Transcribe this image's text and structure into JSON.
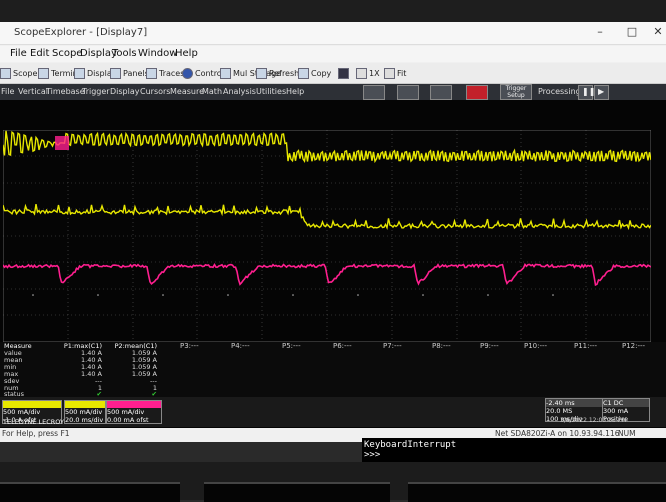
{
  "window": {
    "title": "ScopeExplorer - [Display7]"
  },
  "menu": [
    "File",
    "Edit",
    "Scope",
    "Display",
    "Tools",
    "Window",
    "Help"
  ],
  "toolbar": [
    "Scope",
    "Terminal",
    "Display",
    "Panels",
    "Traces",
    "Control",
    "Mul Storage",
    "Refresh",
    "Copy",
    "1X",
    "Fit"
  ],
  "scope_menu": [
    "File",
    "Vertical",
    "Timebase",
    "Trigger",
    "Display",
    "Cursors",
    "Measure",
    "Math",
    "Analysis",
    "Utilities",
    "Help"
  ],
  "trigger_label": "Trigger Setup",
  "processing_label": "Processing:",
  "measure": {
    "header": [
      "Measure",
      "P1:max(C1)",
      "P2:mean(C1)"
    ],
    "rows": [
      [
        "value",
        "1.40 A",
        "1.059 A"
      ],
      [
        "mean",
        "1.40 A",
        "1.059 A"
      ],
      [
        "min",
        "1.40 A",
        "1.059 A"
      ],
      [
        "max",
        "1.40 A",
        "1.059 A"
      ],
      [
        "sdev",
        "---",
        "---"
      ],
      [
        "num",
        "1",
        "1"
      ],
      [
        "status",
        "✔",
        "✔"
      ]
    ],
    "params": [
      "P3:---",
      "P4:---",
      "P5:---",
      "P6:---",
      "P7:---",
      "P8:---",
      "P9:---",
      "P10:---",
      "P11:---",
      "P12:---"
    ]
  },
  "channels": [
    {
      "name": "C1",
      "scale": "500 mA/div",
      "offset": "-1.0 A ofst",
      "color": "#e8e800"
    },
    {
      "name": "C2",
      "scale": "500 mA/div",
      "offset": "20.0 ms/div",
      "color": "#e8e800"
    },
    {
      "name": "C3",
      "scale": "500 mA/div",
      "offset": "0.00 mA ofst",
      "color": "#ff1f8f"
    }
  ],
  "timebase": {
    "timebase": "-2.40 ms",
    "samples": "20.0 MS",
    "rate": "100 ms/div",
    "srate": "10 MS/s",
    "trigger": "C1 DC",
    "trig_level": "Edge",
    "trig_val": "300 mA",
    "trig_slope": "Positive"
  },
  "datetime": "3/8/2022 12:03:33 PM",
  "brand": "TELEDYNE LECROY",
  "status_help": "For Help, press F1",
  "status_net": "Net SDA820Zi-A on 10.93.94.116",
  "status_num": "NUM",
  "terminal": [
    "KeyboardInterrupt",
    ">>>"
  ],
  "colors": {
    "yellow": "#e8e800",
    "magenta": "#ff1f8f",
    "grid": "#5a5a5a"
  }
}
